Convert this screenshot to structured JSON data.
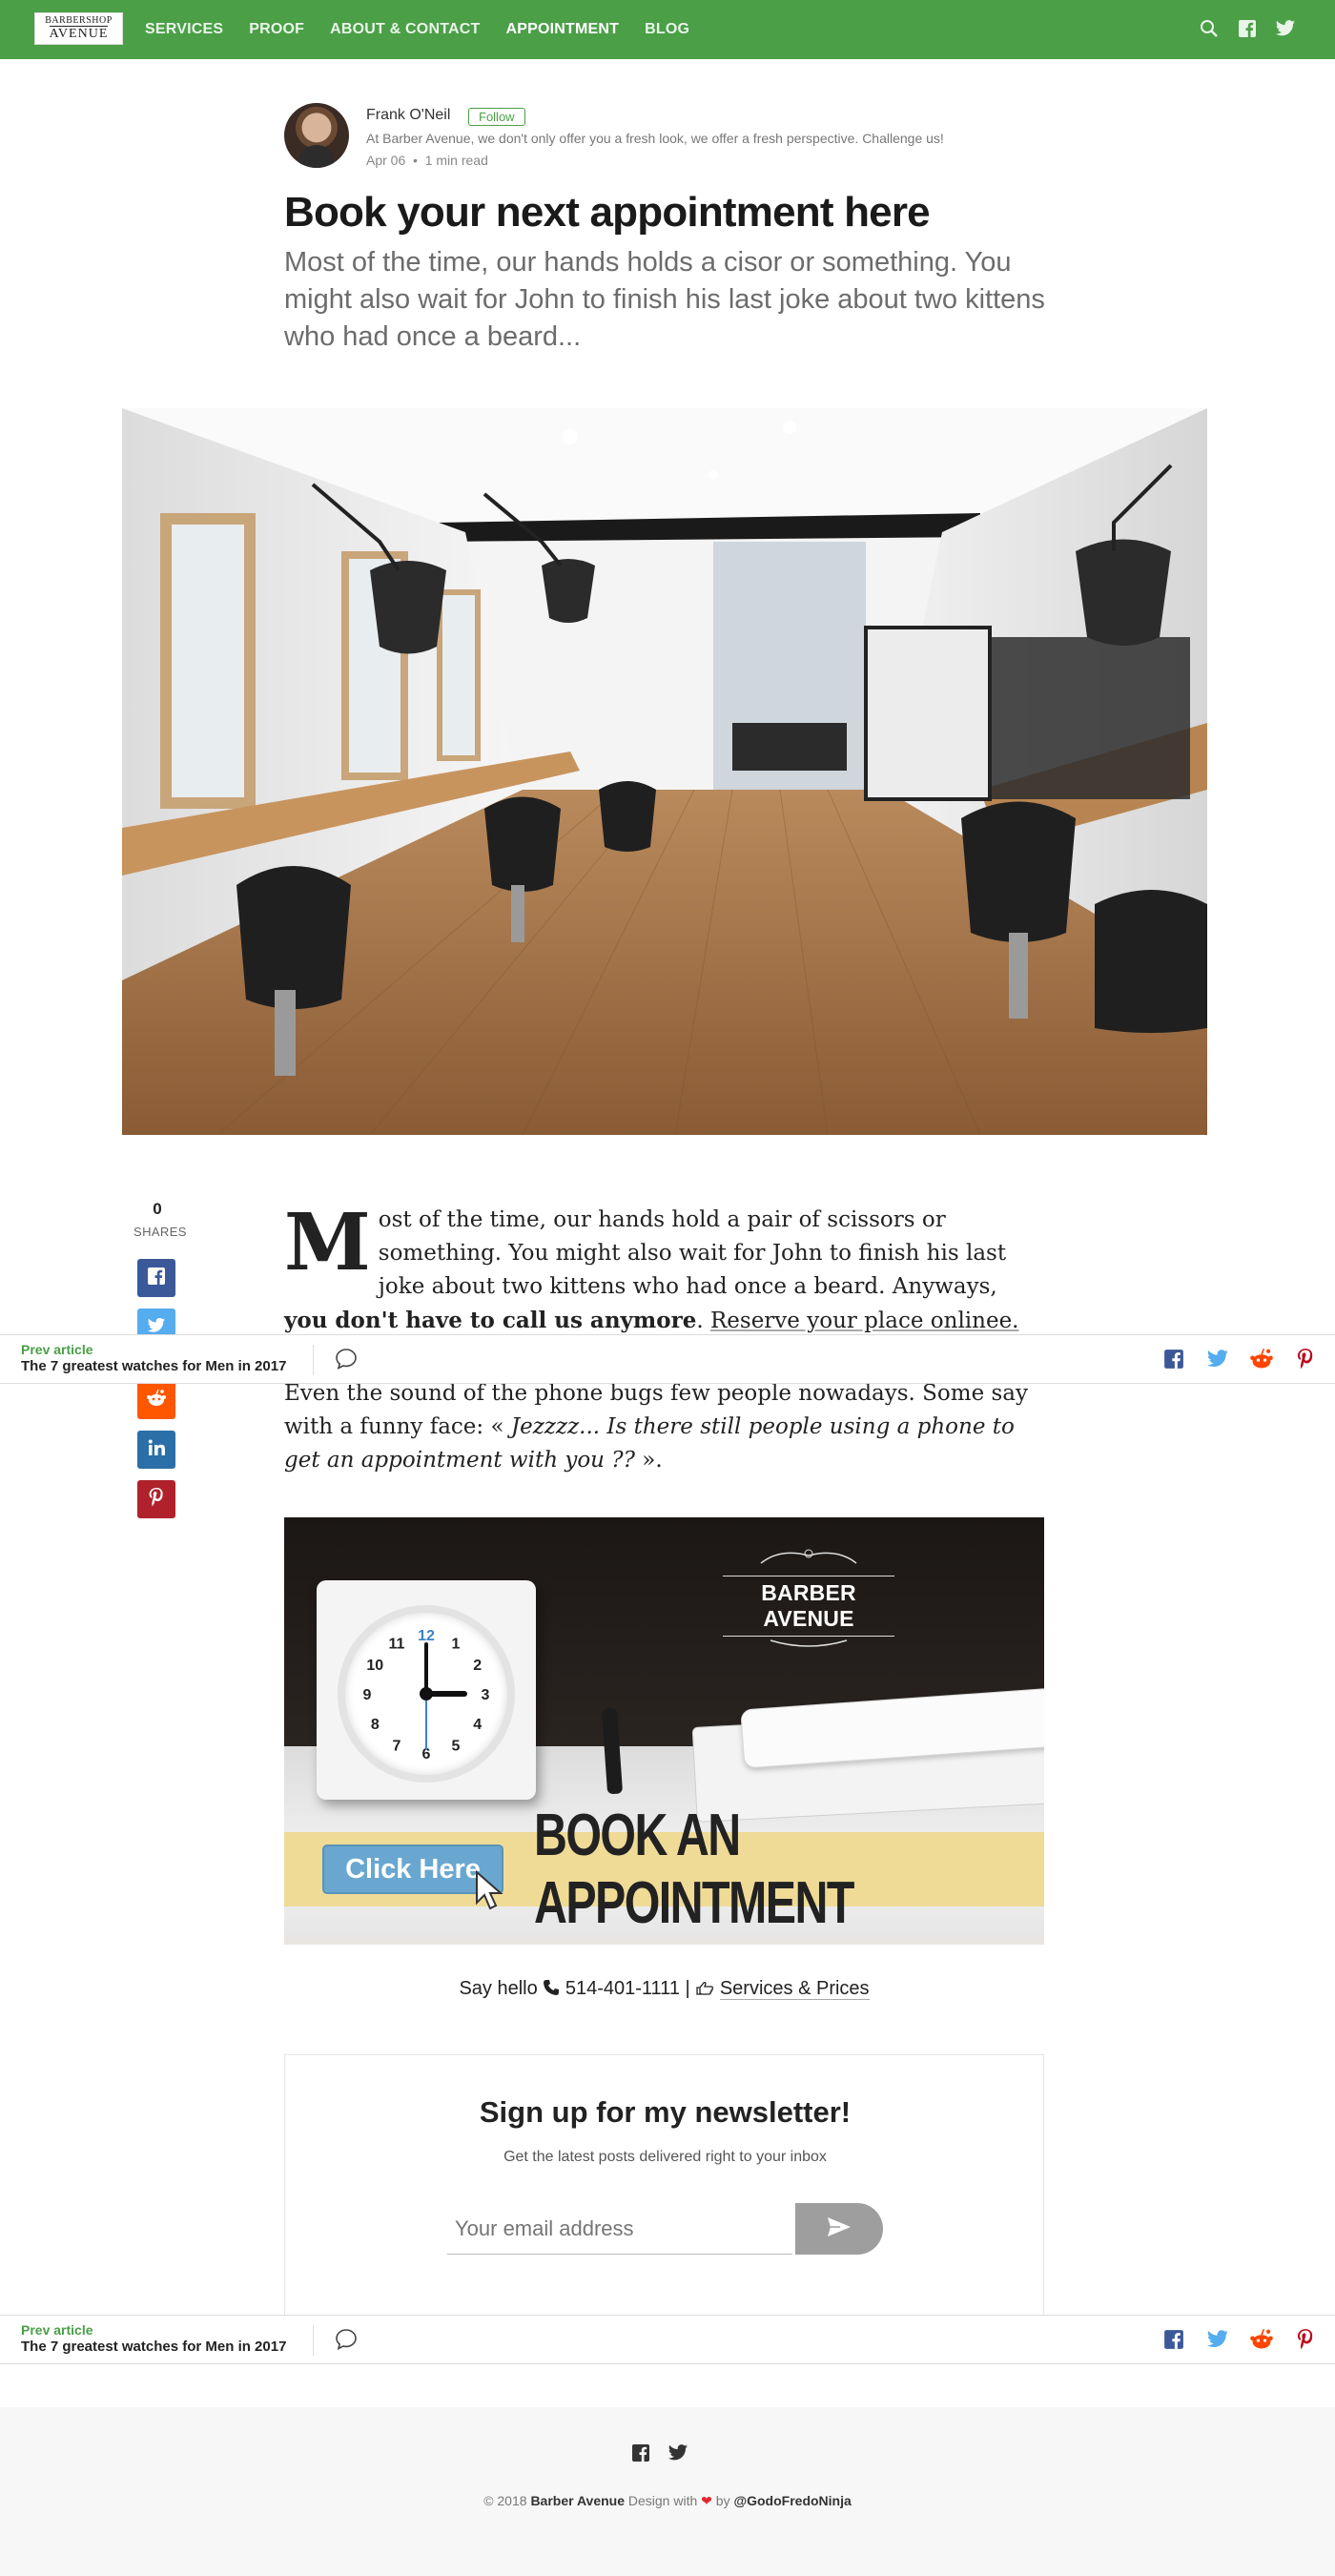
{
  "nav": {
    "logo_top": "BARBERSHOP",
    "logo_bottom": "AVENUE",
    "items": [
      "SERVICES",
      "PROOF",
      "ABOUT & CONTACT",
      "APPOINTMENT",
      "BLOG"
    ],
    "active_item": "APPOINTMENT",
    "icons": [
      "search-icon",
      "facebook-icon",
      "twitter-icon"
    ]
  },
  "author": {
    "name": "Frank O'Neil",
    "follow_label": "Follow",
    "bio": "At Barber Avenue, we don't only offer you a fresh look, we offer a fresh perspective. Challenge us!",
    "date": "Apr 06",
    "read_time": "1 min read"
  },
  "article": {
    "title": "Book your next appointment here",
    "subtitle": "Most of the time, our hands holds a cisor or something. You might also wait for John to finish his last joke about two kittens who had once a beard...",
    "dropcap": "M",
    "p1_text": "ost of the time, our hands hold a pair of scissors or something. You might also wait for John to finish his last joke about two kittens who had once a beard. Anyways, ",
    "p1_bold": "you don't have to call us anymore",
    "p1_end": ".",
    "p1_link": "Reserve your place onlinee.",
    "p2_start": "Even the sound of the phone bugs few people nowadays. Some say with a funny face: « ",
    "p2_italic": "Jezzzz... Is there still people using a phone to get an appointment with you ??",
    "p2_end": " »."
  },
  "share": {
    "count": "0",
    "label": "SHARES",
    "buttons": [
      "facebook-icon",
      "twitter-icon",
      "reddit-icon",
      "linkedin-icon",
      "pinterest-icon"
    ]
  },
  "sticky_bar": {
    "prev_label": "Prev article",
    "prev_title": "The 7 greatest watches for Men in 2017",
    "icons": [
      "comment-icon",
      "facebook-icon",
      "twitter-icon",
      "reddit-icon",
      "pinterest-icon"
    ]
  },
  "banner": {
    "brand": "BARBER AVENUE",
    "button_label": "Click Here",
    "headline": "BOOK AN APPOINTMENT",
    "clock_numbers": [
      "12",
      "1",
      "2",
      "3",
      "4",
      "5",
      "6",
      "7",
      "8",
      "9",
      "10",
      "11"
    ]
  },
  "contact": {
    "hello": "Say hello",
    "phone": "514-401-1111",
    "separator": "|",
    "services": "Services & Prices"
  },
  "newsletter": {
    "title": "Sign up for my newsletter!",
    "subtitle": "Get the latest posts delivered right to your inbox",
    "placeholder": "Your email address"
  },
  "footer": {
    "copyright": "© 2018",
    "site": "Barber Avenue",
    "design_with": "Design with",
    "by": "by",
    "designer": "@GodoFredoNinja"
  },
  "colors": {
    "brand_green": "#4a9f47",
    "facebook": "#3b5998",
    "twitter": "#55acee",
    "reddit": "#ff4500",
    "linkedin": "#0077b5",
    "pinterest": "#bd081c"
  }
}
